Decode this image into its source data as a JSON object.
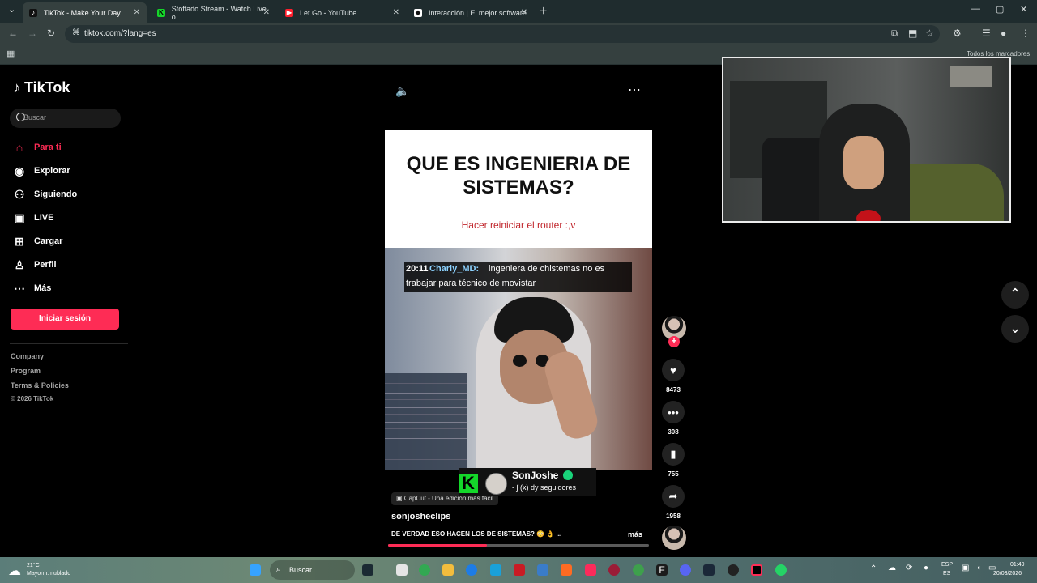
{
  "browser": {
    "tabs": [
      {
        "title": "TikTok - Make Your Day",
        "active": true,
        "icon": "tiktok-icon"
      },
      {
        "title": "Stoffado Stream - Watch Live o",
        "active": false,
        "icon": "kick-icon"
      },
      {
        "title": "Let Go - YouTube",
        "active": false,
        "icon": "youtube-icon"
      },
      {
        "title": "Interacción | El mejor software",
        "active": false,
        "icon": "diamond-icon"
      }
    ],
    "url": "tiktok.com/?lang=es",
    "bookmarks_label": "Todos los marcadores"
  },
  "sidebar": {
    "logo": "TikTok",
    "search_placeholder": "Buscar",
    "items": [
      {
        "label": "Para ti",
        "icon": "home-icon",
        "active": true
      },
      {
        "label": "Explorar",
        "icon": "compass-icon",
        "active": false
      },
      {
        "label": "Siguiendo",
        "icon": "following-icon",
        "active": false
      },
      {
        "label": "LIVE",
        "icon": "live-icon",
        "active": false
      },
      {
        "label": "Cargar",
        "icon": "upload-icon",
        "active": false
      },
      {
        "label": "Perfil",
        "icon": "profile-icon",
        "active": false
      },
      {
        "label": "Más",
        "icon": "more-icon",
        "active": false
      }
    ],
    "login": "Iniciar sesión",
    "footer": [
      "Company",
      "Program",
      "Terms & Policies",
      "© 2026 TikTok"
    ]
  },
  "video": {
    "headline": "QUE ES INGENIERIA DE SISTEMAS?",
    "subline": "Hacer reiniciar el router :,v",
    "chat": {
      "time": "20:11",
      "user": "Charly_MD:",
      "message_line1": "ingeniera de chistemas no es",
      "message_line2": "trabajar para técnico de movistar"
    },
    "capcut": "CapCut - Una edición más fácil",
    "overlay_name": "SonJoshe",
    "overlay_sub": "- ʃ (x) dy seguidores",
    "author": "sonjosheclips",
    "caption": "DE VERDAD ESO HACEN LOS DE SISTEMAS? 😳 👌 ...",
    "more": "más",
    "progress": 0.38
  },
  "actions": {
    "likes": "8473",
    "comments": "308",
    "saves": "755",
    "shares": "1958"
  },
  "taskbar": {
    "weather": "21°C",
    "weather_desc": "Mayorm. nublado",
    "search": "Buscar",
    "lang": "ESP",
    "lang_sub": "ES",
    "time": "01:49",
    "date": "20/03/2026"
  }
}
